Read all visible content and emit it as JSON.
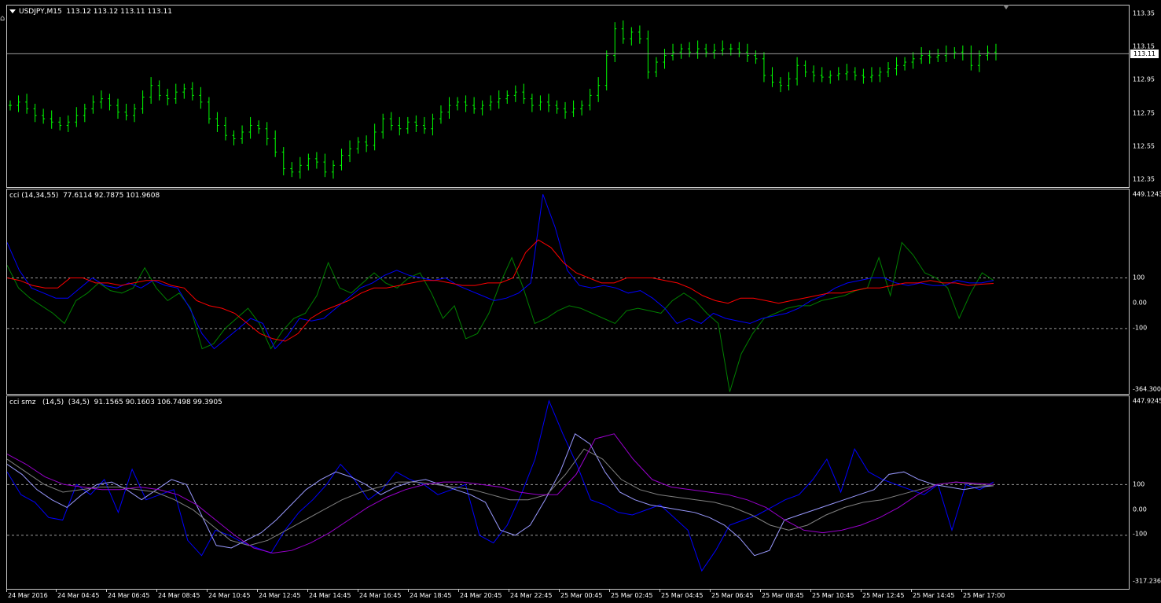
{
  "price_pane": {
    "label": "USDJPY,M15  113.12 113.12 113.11 113.11",
    "axis": [
      "113.35",
      "113.15",
      "112.95",
      "112.75",
      "112.55",
      "112.35"
    ],
    "current_price": "113.11",
    "bar_color": "#00ff00"
  },
  "cci_pane": {
    "label": "cci (14,34,55)  77.6114 92.7875 101.9608",
    "axis_top": "449.1243",
    "axis_levels": [
      "100",
      "0.00",
      "-100"
    ],
    "axis_bottom": "-364.300",
    "colors": [
      "#008000",
      "#0000ff",
      "#ff0000"
    ]
  },
  "smz_pane": {
    "label": "cci smz   (14,5)  (34,5)  91.1565 90.1603 106.7498 99.3905",
    "axis_top": "447.9245",
    "axis_levels": [
      "100",
      "0.00",
      "-100"
    ],
    "axis_bottom": "-317.236",
    "colors": [
      "#0000ff",
      "#9999ff",
      "#808080",
      "#9900cc"
    ]
  },
  "time_axis": [
    "24 Mar 2016",
    "24 Mar 04:45",
    "24 Mar 06:45",
    "24 Mar 08:45",
    "24 Mar 10:45",
    "24 Mar 12:45",
    "24 Mar 14:45",
    "24 Mar 16:45",
    "24 Mar 18:45",
    "24 Mar 20:45",
    "24 Mar 22:45",
    "25 Mar 00:45",
    "25 Mar 02:45",
    "25 Mar 04:45",
    "25 Mar 06:45",
    "25 Mar 08:45",
    "25 Mar 10:45",
    "25 Mar 12:45",
    "25 Mar 14:45",
    "25 Mar 17:00"
  ],
  "chart_data": [
    {
      "type": "ohlc",
      "title": "USDJPY,M15",
      "ylim": [
        112.3,
        113.4
      ],
      "close_series": [
        112.8,
        112.82,
        112.78,
        112.74,
        112.72,
        112.7,
        112.68,
        112.7,
        112.74,
        112.78,
        112.82,
        112.84,
        112.8,
        112.76,
        112.74,
        112.78,
        112.85,
        112.92,
        112.86,
        112.84,
        112.88,
        112.9,
        112.86,
        112.82,
        112.72,
        112.68,
        112.62,
        112.6,
        112.64,
        112.68,
        112.66,
        112.6,
        112.52,
        112.42,
        112.4,
        112.44,
        112.48,
        112.46,
        112.4,
        112.44,
        112.5,
        112.54,
        112.58,
        112.56,
        112.64,
        112.72,
        112.68,
        112.66,
        112.7,
        112.68,
        112.66,
        112.72,
        112.76,
        112.8,
        112.82,
        112.8,
        112.78,
        112.8,
        112.82,
        112.84,
        112.86,
        112.88,
        112.84,
        112.8,
        112.82,
        112.8,
        112.78,
        112.76,
        112.78,
        112.8,
        112.86,
        112.92,
        113.1,
        113.26,
        113.2,
        113.24,
        113.2,
        113.0,
        113.06,
        113.1,
        113.12,
        113.14,
        113.12,
        113.14,
        113.12,
        113.13,
        113.14,
        113.14,
        113.12,
        113.1,
        113.08,
        112.98,
        112.94,
        112.92,
        112.96,
        113.04,
        113.0,
        112.98,
        112.97,
        112.98,
        112.99,
        113.0,
        112.98,
        112.97,
        112.98,
        113.0,
        113.02,
        113.04,
        113.06,
        113.08,
        113.1,
        113.09,
        113.1,
        113.11,
        113.12,
        113.11,
        113.04,
        113.1,
        113.12,
        113.11
      ]
    },
    {
      "type": "line",
      "title": "cci (14,34,55)",
      "ylim": [
        -364.3,
        449.1243
      ],
      "series": [
        {
          "name": "cci 14",
          "values": [
            150,
            60,
            20,
            -10,
            -40,
            -80,
            10,
            40,
            80,
            50,
            40,
            60,
            140,
            60,
            10,
            40,
            -20,
            -180,
            -160,
            -100,
            -60,
            -20,
            -80,
            -180,
            -110,
            -60,
            -40,
            30,
            160,
            60,
            40,
            80,
            120,
            80,
            60,
            100,
            120,
            40,
            -60,
            -10,
            -140,
            -120,
            -40,
            80,
            180,
            60,
            -80,
            -60,
            -30,
            -10,
            -20,
            -40,
            -60,
            -80,
            -30,
            -20,
            -30,
            -40,
            10,
            40,
            10,
            -40,
            -80,
            -350,
            -200,
            -120,
            -60,
            -40,
            -20,
            -10,
            -10,
            10,
            20,
            30,
            50,
            60,
            180,
            30,
            240,
            190,
            120,
            100,
            60,
            -60,
            40,
            120,
            90
          ]
        },
        {
          "name": "cci 34",
          "values": [
            240,
            130,
            60,
            40,
            20,
            20,
            60,
            100,
            70,
            60,
            80,
            60,
            90,
            70,
            60,
            -20,
            -120,
            -180,
            -140,
            -100,
            -60,
            -80,
            -180,
            -130,
            -60,
            -70,
            -60,
            -20,
            20,
            60,
            80,
            110,
            130,
            110,
            100,
            90,
            100,
            70,
            50,
            30,
            10,
            20,
            40,
            80,
            430,
            300,
            130,
            70,
            60,
            70,
            60,
            40,
            50,
            20,
            -20,
            -80,
            -60,
            -80,
            -40,
            -60,
            -70,
            -80,
            -60,
            -50,
            -40,
            -20,
            10,
            30,
            60,
            80,
            90,
            100,
            100,
            80,
            70,
            80,
            70,
            70,
            90,
            80,
            80,
            90
          ]
        },
        {
          "name": "cci 55",
          "values": [
            100,
            90,
            70,
            60,
            60,
            100,
            100,
            80,
            80,
            70,
            80,
            90,
            90,
            70,
            60,
            10,
            -10,
            -20,
            -40,
            -80,
            -120,
            -140,
            -150,
            -120,
            -60,
            -30,
            -10,
            10,
            40,
            60,
            60,
            70,
            80,
            90,
            90,
            80,
            70,
            70,
            80,
            80,
            100,
            200,
            250,
            220,
            160,
            120,
            100,
            80,
            80,
            100,
            100,
            100,
            90,
            80,
            60,
            30,
            10,
            0,
            20,
            20,
            10,
            0,
            10,
            20,
            30,
            40,
            40,
            50,
            60,
            60,
            70,
            80,
            80,
            90,
            80,
            80,
            70,
            75,
            78
          ]
        }
      ]
    },
    {
      "type": "line",
      "title": "cci smz",
      "ylim": [
        -317.236,
        447.9245
      ],
      "series": [
        {
          "name": "cci smz 1",
          "values": [
            150,
            60,
            30,
            -30,
            -40,
            100,
            60,
            120,
            -10,
            160,
            40,
            60,
            80,
            -120,
            -180,
            -80,
            -100,
            -130,
            -150,
            -170,
            -80,
            -10,
            40,
            100,
            180,
            120,
            40,
            80,
            150,
            120,
            100,
            60,
            80,
            100,
            -100,
            -130,
            -60,
            60,
            200,
            430,
            300,
            180,
            40,
            20,
            -10,
            -20,
            0,
            20,
            -30,
            -80,
            -240,
            -160,
            -60,
            -40,
            -20,
            10,
            40,
            60,
            120,
            200,
            70,
            240,
            150,
            120,
            100,
            80,
            60,
            100,
            -80,
            100,
            80,
            110
          ]
        },
        {
          "name": "cci smz 2",
          "values": [
            180,
            140,
            80,
            40,
            10,
            60,
            100,
            110,
            80,
            40,
            80,
            120,
            100,
            -20,
            -140,
            -150,
            -120,
            -90,
            -40,
            20,
            80,
            120,
            150,
            130,
            100,
            60,
            90,
            110,
            120,
            100,
            80,
            60,
            30,
            -80,
            -100,
            -60,
            40,
            150,
            300,
            260,
            150,
            70,
            40,
            20,
            10,
            0,
            -10,
            -30,
            -60,
            -110,
            -180,
            -160,
            -40,
            -20,
            0,
            20,
            40,
            60,
            80,
            140,
            150,
            120,
            100,
            90,
            80,
            90,
            95
          ]
        },
        {
          "name": "cci smz 3",
          "values": [
            200,
            150,
            100,
            70,
            80,
            90,
            90,
            80,
            70,
            40,
            0,
            -60,
            -120,
            -140,
            -120,
            -80,
            -40,
            0,
            40,
            70,
            90,
            110,
            110,
            100,
            90,
            80,
            60,
            40,
            40,
            60,
            140,
            240,
            200,
            120,
            80,
            60,
            50,
            40,
            30,
            10,
            -20,
            -60,
            -80,
            -60,
            -20,
            10,
            30,
            40,
            60,
            80,
            100,
            110,
            100,
            95
          ]
        },
        {
          "name": "cci smz 4",
          "values": [
            220,
            180,
            130,
            100,
            90,
            80,
            80,
            90,
            80,
            60,
            20,
            -40,
            -100,
            -150,
            -170,
            -160,
            -130,
            -90,
            -40,
            10,
            50,
            80,
            100,
            110,
            110,
            100,
            90,
            70,
            60,
            60,
            140,
            280,
            300,
            200,
            120,
            90,
            80,
            70,
            60,
            40,
            10,
            -40,
            -80,
            -90,
            -80,
            -60,
            -30,
            10,
            60,
            100,
            110,
            105,
            100
          ]
        }
      ]
    }
  ]
}
